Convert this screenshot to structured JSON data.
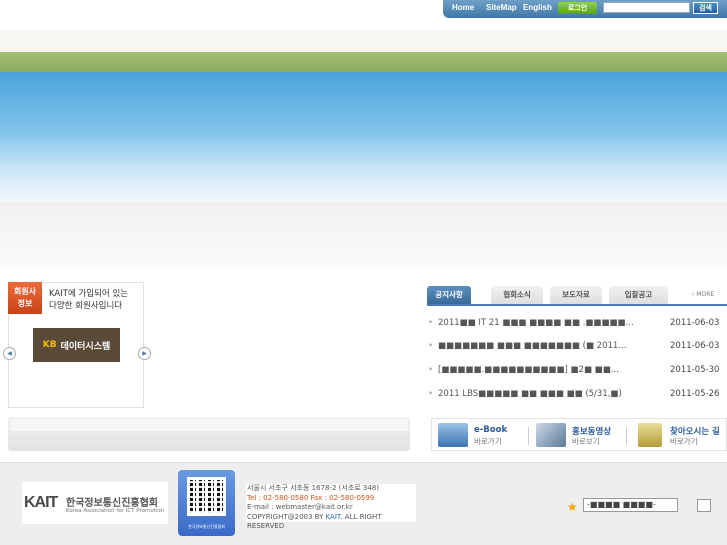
{
  "topnav": {
    "home": "Home",
    "sitemap": "SiteMap",
    "english": "English",
    "login": "로그인",
    "search_button": "검색",
    "search_placeholder": ""
  },
  "member": {
    "tag_line1": "회원사",
    "tag_line2": "정보",
    "desc_line1": "KAIT에 가입되어 있는",
    "desc_line2": "다양한 회원사입니다",
    "logo_text": "데이터시스템",
    "logo_mark": "KB",
    "prev_label": "◀",
    "next_label": "▶"
  },
  "notices": {
    "tabs": [
      {
        "label": "공지사항"
      },
      {
        "label": "협회소식"
      },
      {
        "label": "보도자료"
      },
      {
        "label": "입찰공고"
      }
    ],
    "more": "› MORE",
    "items": [
      {
        "title": "2011■■ IT 21 ■■■ ■■■■ ■■ .■■■■■...",
        "date": "2011-06-03"
      },
      {
        "title": "■■■■■■■ ■■■ ■■■■■■■ (■ 2011...",
        "date": "2011-06-03"
      },
      {
        "title": "[■■■■■.■■■■■■■■■■] ■2■ ■■...",
        "date": "2011-05-30"
      },
      {
        "title": "2011 LBS■■■■■ ■■ ■■■ ■■ (5/31,■)",
        "date": "2011-05-26"
      }
    ]
  },
  "quicklinks": [
    {
      "title": "e-Book",
      "sub": "바로가기",
      "icon": "laptop-icon"
    },
    {
      "title": "홍보동영상",
      "sub": "바로보기",
      "icon": "video-icon"
    },
    {
      "title": "찾아오시는 길",
      "sub": "바로가기",
      "icon": "signpost-icon"
    }
  ],
  "footer": {
    "logo_text": "KAIT",
    "logo_kor": "한국정보통신진흥협회",
    "logo_eng": "Korea Association for ICT Promotion",
    "qr_caption": "한국정보통신진흥협회",
    "address": "서울시 서초구 서초동 1678-2 (서초로 348)",
    "tel": "Tel : 02-580-0580   Fax : 02-580-0599",
    "email": "E-mail : webmaster@kait.or.kr",
    "copyright_prefix": "COPYRIGHT@2003 BY ",
    "copyright_brand": "KAIT",
    "copyright_suffix": ". ALL RIGHT RESERVED",
    "family_select": "-■■■■ ■■■■-"
  },
  "colors": {
    "topbar": "#4f86b8",
    "login": "#6cbf2a",
    "active_tab": "#4a7ab0",
    "member_tag": "#e05a2a"
  }
}
